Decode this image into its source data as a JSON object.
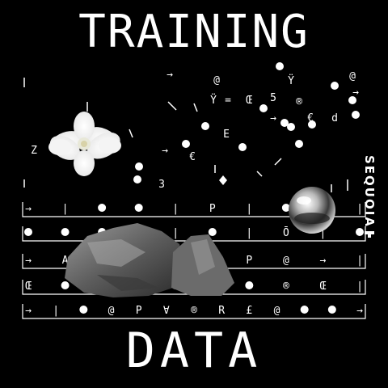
{
  "title_top": "TRAINING",
  "title_bottom": "DATA",
  "brand": "SEQUOIA",
  "colors": {
    "background": "#000000",
    "foreground": "#ffffff"
  },
  "rows": [
    [
      "→",
      "|",
      "•",
      "•",
      "|",
      "P",
      "|",
      "•",
      "E",
      "|"
    ],
    [
      "•",
      "•",
      "•",
      "•",
      "|",
      "•",
      "|",
      "Ō",
      "|",
      "•"
    ],
    [
      "→",
      "A",
      "|",
      "→",
      "•",
      "U",
      "P",
      "@",
      "→",
      "|"
    ],
    [
      "Œ",
      "•",
      "|",
      "→",
      "•",
      "©",
      "•",
      "®",
      "Œ",
      "|"
    ],
    [
      "→",
      "|",
      "•",
      "@",
      "P",
      "∀",
      "®",
      "R",
      "£",
      "@",
      "•",
      "•",
      "→"
    ]
  ],
  "scatter_glyphs": [
    "@",
    "Ÿ",
    "=",
    "Œ",
    "5",
    "®",
    "€",
    "d",
    "→",
    "Ÿ",
    "@",
    "→",
    "E",
    "→",
    "€",
    "3",
    "Z",
    "→",
    "•",
    "◆"
  ],
  "objects": [
    "flower",
    "stone",
    "chrome-sphere"
  ]
}
